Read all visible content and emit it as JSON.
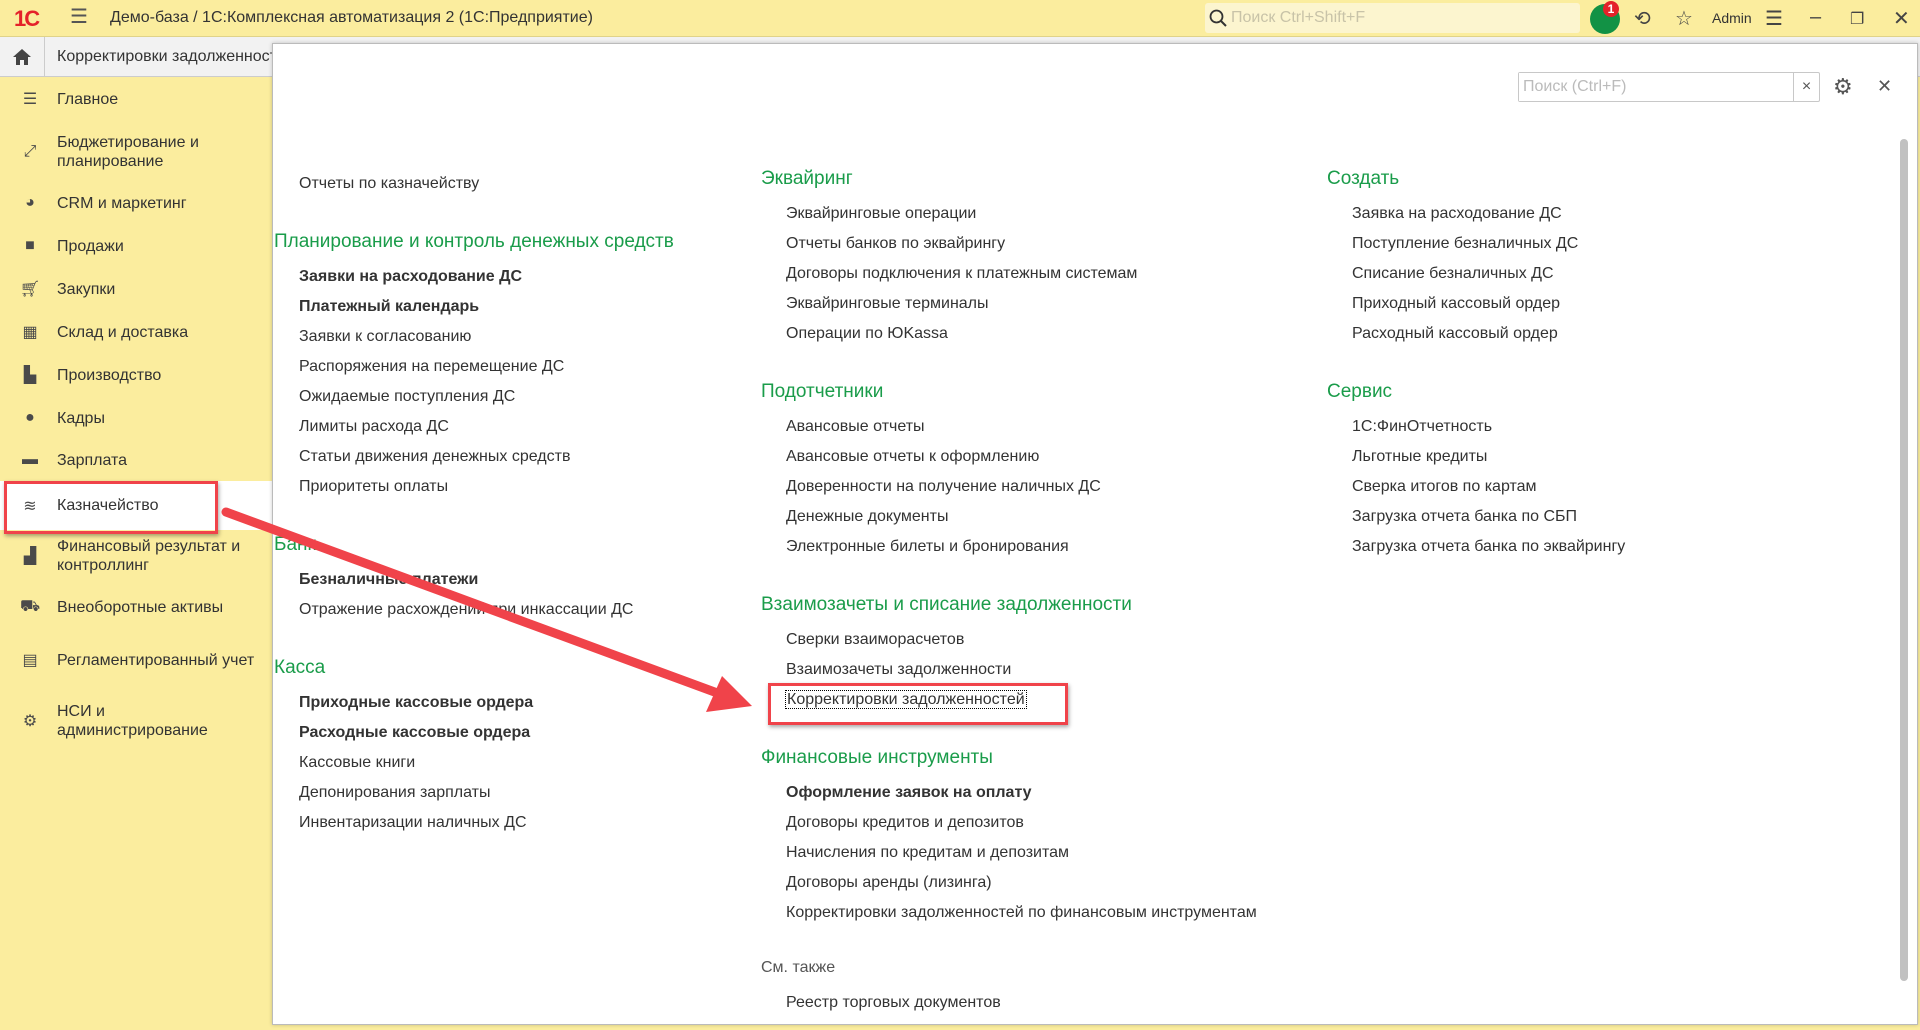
{
  "header": {
    "title": "Демо-база / 1С:Комплексная автоматизация 2  (1С:Предприятие)",
    "logo": "1С",
    "search_placeholder": "Поиск Ctrl+Shift+F",
    "notifications": "1",
    "user": "Admin"
  },
  "tab": {
    "label": "Корректировки задолженностей"
  },
  "sidebar": {
    "items": [
      {
        "label": "Главное",
        "icon": "menu-icon"
      },
      {
        "label": "Бюджетирование и планирование",
        "icon": "budget-icon"
      },
      {
        "label": "CRM и маркетинг",
        "icon": "pie-chart-icon"
      },
      {
        "label": "Продажи",
        "icon": "bag-icon"
      },
      {
        "label": "Закупки",
        "icon": "cart-icon"
      },
      {
        "label": "Склад и доставка",
        "icon": "warehouse-icon"
      },
      {
        "label": "Производство",
        "icon": "factory-icon"
      },
      {
        "label": "Кадры",
        "icon": "person-icon"
      },
      {
        "label": "Зарплата",
        "icon": "card-icon"
      },
      {
        "label": "Казначейство",
        "icon": "coins-icon"
      },
      {
        "label": "Финансовый результат и контроллинг",
        "icon": "bar-chart-icon"
      },
      {
        "label": "Внеоборотные активы",
        "icon": "truck-icon"
      },
      {
        "label": "Регламентированный учет",
        "icon": "calculator-icon"
      },
      {
        "label": "НСИ и администрирование",
        "icon": "gear-icon"
      }
    ]
  },
  "panel": {
    "search_placeholder": "Поиск (Ctrl+F)"
  },
  "columns": [
    {
      "top_item": "Отчеты по казначейству",
      "sections": [
        {
          "title": "Планирование и контроль денежных средств",
          "items": [
            "Заявки на расходование ДС",
            "Платежный календарь",
            "Заявки к согласованию",
            "Распоряжения на перемещение ДС",
            "Ожидаемые поступления ДС",
            "Лимиты расхода ДС",
            "Статьи движения денежных средств",
            "Приоритеты оплаты"
          ]
        },
        {
          "title": "Банк",
          "items": [
            "Безналичные платежи",
            "Отражение расхождений при инкассации ДС"
          ]
        },
        {
          "title": "Касса",
          "items": [
            "Приходные кассовые ордера",
            "Расходные кассовые ордера",
            "Кассовые книги",
            "Депонирования зарплаты",
            "Инвентаризации наличных ДС"
          ]
        }
      ]
    },
    {
      "sections": [
        {
          "title": "Эквайринг",
          "items": [
            "Эквайринговые операции",
            "Отчеты банков по эквайрингу",
            "Договоры подключения к платежным системам",
            "Эквайринговые терминалы",
            "Операции по ЮKassa"
          ]
        },
        {
          "title": "Подотчетники",
          "items": [
            "Авансовые отчеты",
            "Авансовые отчеты к оформлению",
            "Доверенности на получение наличных ДС",
            "Денежные документы",
            "Электронные билеты и бронирования"
          ]
        },
        {
          "title": "Взаимозачеты и списание задолженности",
          "items": [
            "Сверки взаиморасчетов",
            "Взаимозачеты задолженности",
            "Корректировки задолженностей"
          ]
        },
        {
          "title": "Финансовые инструменты",
          "items": [
            "Оформление заявок на оплату",
            "Договоры кредитов и депозитов",
            "Начисления по кредитам и депозитам",
            "Договоры аренды (лизинга)",
            "Корректировки задолженностей по финансовым инструментам"
          ]
        },
        {
          "title": "См. также",
          "items": [
            "Реестр торговых документов"
          ]
        }
      ]
    },
    {
      "sections": [
        {
          "title": "Создать",
          "items": [
            "Заявка на расходование ДС",
            "Поступление безналичных ДС",
            "Списание безналичных ДС",
            "Приходный кассовый ордер",
            "Расходный кассовый ордер"
          ]
        },
        {
          "title": "Сервис",
          "items": [
            "1С:ФинОтчетность",
            "Льготные кредиты",
            "Сверка итогов по картам",
            "Загрузка отчета банка по СБП",
            "Загрузка отчета банка по эквайрингу"
          ]
        }
      ]
    }
  ],
  "colors": {
    "accent_green": "#1a9c4a",
    "sidebar_bg": "#fbed9e",
    "annotation_red": "#f0434a"
  }
}
